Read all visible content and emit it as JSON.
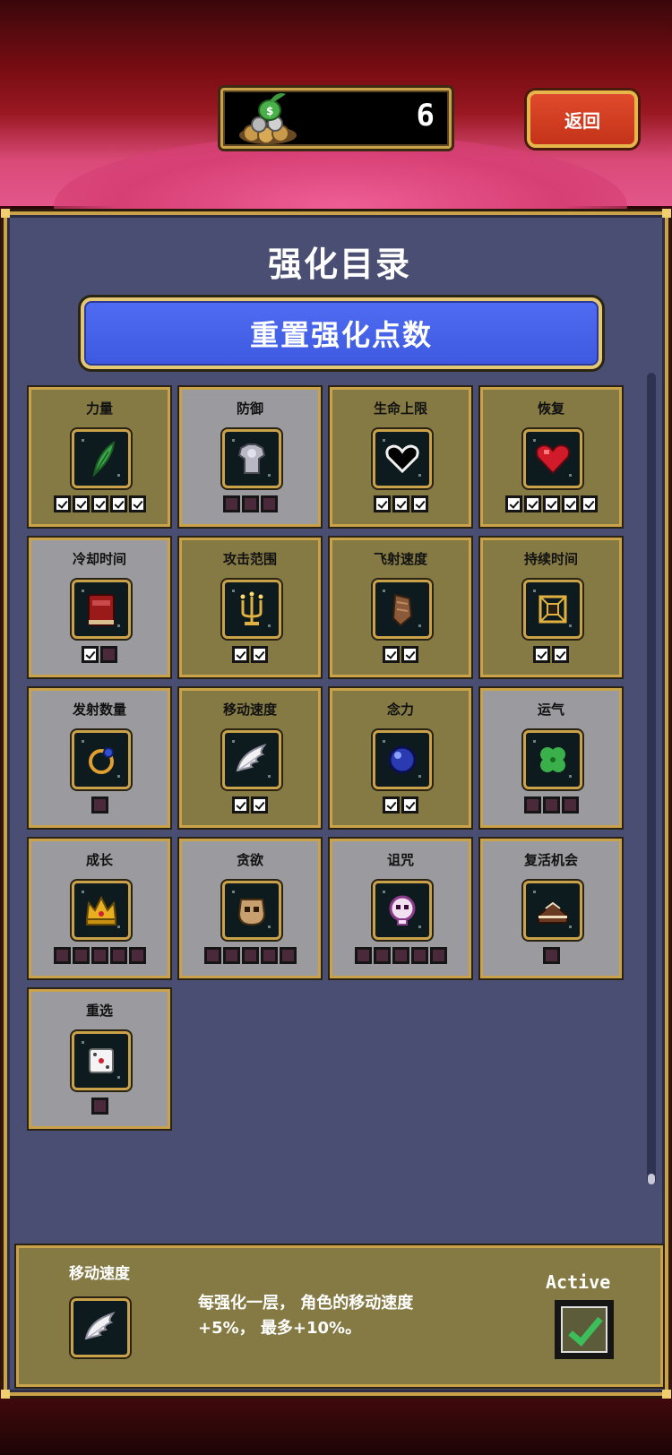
{
  "currency": {
    "value": "6",
    "icon": "seed-coin-pile-icon"
  },
  "back_button": {
    "label": "返回"
  },
  "panel": {
    "title": "强化目录",
    "reset_label": "重置强化点数"
  },
  "upgrades": [
    {
      "label": "力量",
      "icon": "feather-icon",
      "active": true,
      "pips": [
        true,
        true,
        true,
        true,
        true
      ]
    },
    {
      "label": "防御",
      "icon": "armor-icon",
      "active": false,
      "pips": [
        false,
        false,
        false
      ]
    },
    {
      "label": "生命上限",
      "icon": "black-heart-icon",
      "active": true,
      "pips": [
        true,
        true,
        true
      ]
    },
    {
      "label": "恢复",
      "icon": "red-heart-icon",
      "active": true,
      "pips": [
        true,
        true,
        true,
        true,
        true
      ]
    },
    {
      "label": "冷却时间",
      "icon": "tome-icon",
      "active": false,
      "pips": [
        true,
        false
      ]
    },
    {
      "label": "攻击范围",
      "icon": "candelabra-icon",
      "active": true,
      "pips": [
        true,
        true
      ]
    },
    {
      "label": "飞射速度",
      "icon": "bracer-icon",
      "active": true,
      "pips": [
        true,
        true
      ]
    },
    {
      "label": "持续时间",
      "icon": "spellbinder-icon",
      "active": true,
      "pips": [
        true,
        true
      ]
    },
    {
      "label": "发射数量",
      "icon": "ring-icon",
      "active": false,
      "pips": [
        false
      ]
    },
    {
      "label": "移动速度",
      "icon": "wings-icon",
      "active": true,
      "pips": [
        true,
        true
      ]
    },
    {
      "label": "念力",
      "icon": "orb-icon",
      "active": true,
      "pips": [
        true,
        true
      ]
    },
    {
      "label": "运气",
      "icon": "clover-icon",
      "active": false,
      "pips": [
        false,
        false,
        false
      ]
    },
    {
      "label": "成长",
      "icon": "crown-icon",
      "active": false,
      "pips": [
        false,
        false,
        false,
        false,
        false
      ]
    },
    {
      "label": "贪欲",
      "icon": "mask-icon",
      "active": false,
      "pips": [
        false,
        false,
        false,
        false,
        false
      ]
    },
    {
      "label": "诅咒",
      "icon": "skull-icon",
      "active": false,
      "pips": [
        false,
        false,
        false,
        false,
        false
      ]
    },
    {
      "label": "复活机会",
      "icon": "cake-icon",
      "active": false,
      "pips": [
        false
      ]
    },
    {
      "label": "重选",
      "icon": "dice-icon",
      "active": false,
      "pips": [
        false
      ]
    }
  ],
  "detail": {
    "title": "移动速度",
    "icon": "wings-icon",
    "description_line1": "每强化一层， 角色的移动速度",
    "description_line2": "+5%， 最多+10%。",
    "active_label": "Active",
    "active": true
  },
  "colors": {
    "panel_bg": "#4a4e72",
    "gold_border": "#c9a24a",
    "card_active": "#857a44",
    "card_inactive": "#9a9a9f",
    "reset_blue": "#4f6cf2",
    "back_red": "#d43e22"
  }
}
